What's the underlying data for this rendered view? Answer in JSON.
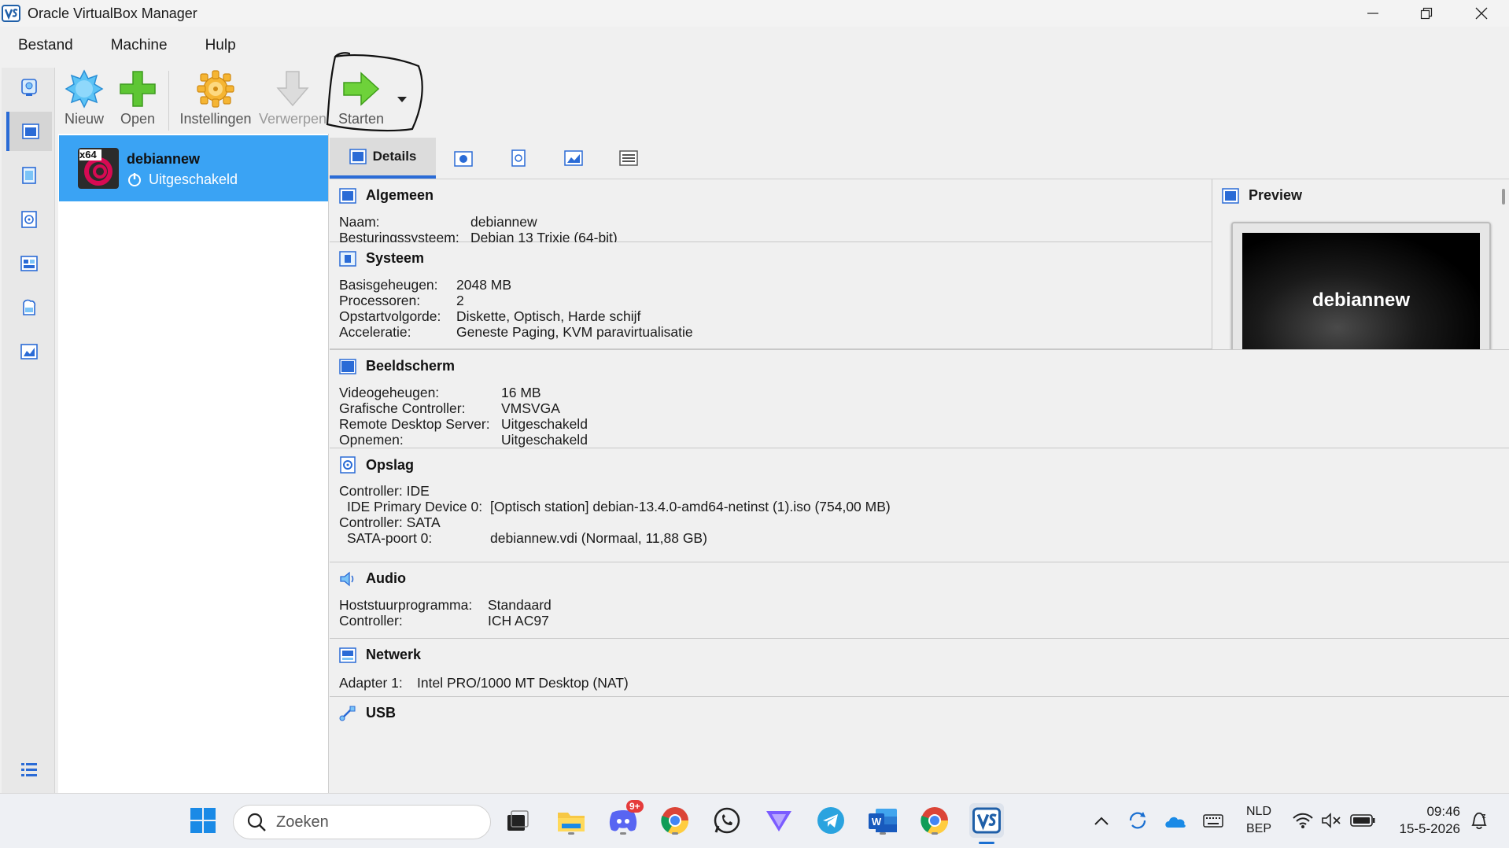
{
  "window": {
    "title": "Oracle VirtualBox Manager"
  },
  "menu": [
    "Bestand",
    "Machine",
    "Hulp"
  ],
  "toolbar": {
    "new_label": "Nieuw",
    "open_label": "Open",
    "settings_label": "Instellingen",
    "discard_label": "Verwerpen",
    "start_label": "Starten"
  },
  "vm_list": [
    {
      "name": "debiannew",
      "state": "Uitgeschakeld",
      "arch_badge": "x64"
    }
  ],
  "tabs": {
    "details_label": "Details"
  },
  "details": {
    "general": {
      "title": "Algemeen",
      "rows": [
        {
          "label": "Naam:",
          "value": "debiannew"
        },
        {
          "label": "Besturingssysteem:",
          "value": "Debian 13 Trixie (64-bit)"
        }
      ]
    },
    "system": {
      "title": "Systeem",
      "rows": [
        {
          "label": "Basisgeheugen:",
          "value": "2048 MB"
        },
        {
          "label": "Processoren:",
          "value": "2"
        },
        {
          "label": "Opstartvolgorde:",
          "value": "Diskette, Optisch, Harde schijf"
        },
        {
          "label": "Acceleratie:",
          "value": "Geneste Paging, KVM paravirtualisatie"
        }
      ]
    },
    "display": {
      "title": "Beeldscherm",
      "rows": [
        {
          "label": "Videogeheugen:",
          "value": "16 MB"
        },
        {
          "label": "Grafische Controller:",
          "value": "VMSVGA"
        },
        {
          "label": "Remote Desktop Server:",
          "value": "Uitgeschakeld"
        },
        {
          "label": "Opnemen:",
          "value": "Uitgeschakeld"
        }
      ]
    },
    "storage": {
      "title": "Opslag",
      "rows": [
        {
          "label": "Controller: IDE",
          "value": ""
        },
        {
          "label": "IDE Primary Device 0:",
          "value": "[Optisch station] debian-13.4.0-amd64-netinst (1).iso (754,00 MB)"
        },
        {
          "label": "Controller: SATA",
          "value": ""
        },
        {
          "label": "SATA-poort 0:",
          "value": "debiannew.vdi (Normaal, 11,88 GB)"
        }
      ]
    },
    "audio": {
      "title": "Audio",
      "rows": [
        {
          "label": "Hoststuurprogramma:",
          "value": "Standaard"
        },
        {
          "label": "Controller:",
          "value": "ICH AC97"
        }
      ]
    },
    "network": {
      "title": "Netwerk",
      "rows": [
        {
          "label": "Adapter 1:",
          "value": "Intel PRO/1000 MT Desktop (NAT)"
        }
      ]
    },
    "usb": {
      "title": "USB"
    }
  },
  "preview": {
    "title": "Preview",
    "screen_text": "debiannew"
  },
  "taskbar": {
    "search_placeholder": "Zoeken",
    "discord_badge": "9+",
    "lang_line1": "NLD",
    "lang_line2": "BEP",
    "time": "09:46",
    "date": "15-5-2026"
  },
  "colors": {
    "selection": "#3aa3f4",
    "accent": "#2a6bd6"
  }
}
